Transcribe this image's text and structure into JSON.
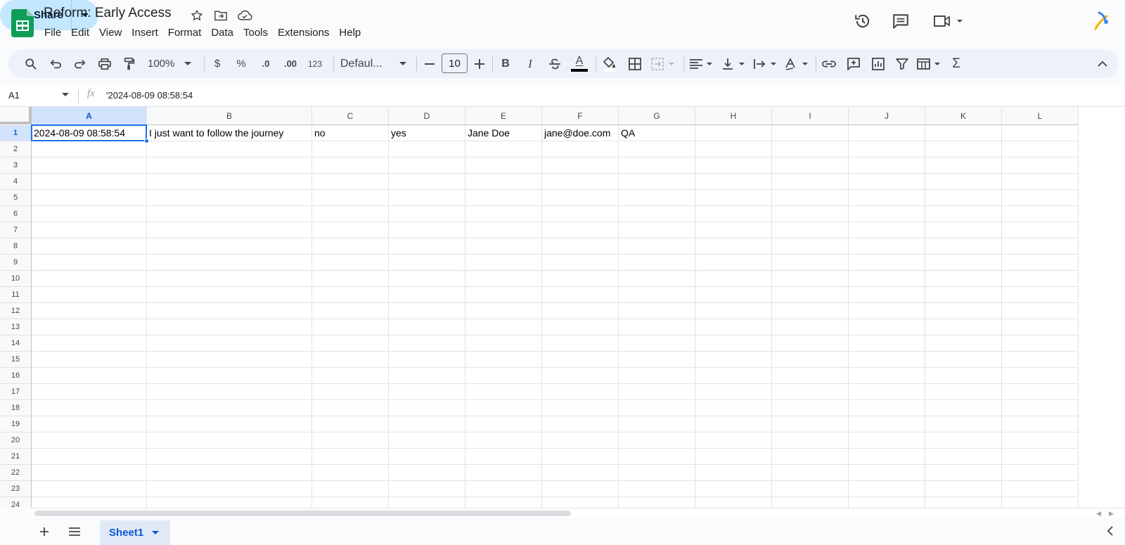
{
  "header": {
    "doc_title": "Reform: Early Access",
    "menu": [
      "File",
      "Edit",
      "View",
      "Insert",
      "Format",
      "Data",
      "Tools",
      "Extensions",
      "Help"
    ],
    "share_label": "Share"
  },
  "toolbar": {
    "zoom": "100%",
    "currency": "$",
    "percent": "%",
    "decrease_decimal": ".0",
    "increase_decimal": ".00",
    "number_format": "123",
    "font": "Defaul...",
    "font_size": "10",
    "bold": "B",
    "italic": "I",
    "text_color_letter": "A",
    "sum": "Σ"
  },
  "formula_bar": {
    "name_box": "A1",
    "fx": "fx",
    "value": "'2024-08-09 08:58:54"
  },
  "grid": {
    "columns": [
      "A",
      "B",
      "C",
      "D",
      "E",
      "F",
      "G",
      "H",
      "I",
      "J",
      "K",
      "L"
    ],
    "selected_column": "A",
    "rows": [
      "1",
      "2",
      "3",
      "4",
      "5",
      "6",
      "7",
      "8",
      "9",
      "10",
      "11",
      "12",
      "13",
      "14",
      "15",
      "16",
      "17",
      "18",
      "19",
      "20",
      "21",
      "22",
      "23",
      "24"
    ],
    "selected_row": "1",
    "row1": [
      "2024-08-09 08:58:54",
      "I just want to follow the journey",
      "no",
      "yes",
      "Jane Doe",
      "jane@doe.com",
      "QA",
      "",
      "",
      "",
      "",
      ""
    ]
  },
  "sheets": {
    "active": "Sheet1"
  },
  "colors": {
    "accent": "#0b57d0",
    "selection": "#1a73e8",
    "share_bg": "#c2e7ff",
    "sheets_green": "#0f9d58"
  }
}
